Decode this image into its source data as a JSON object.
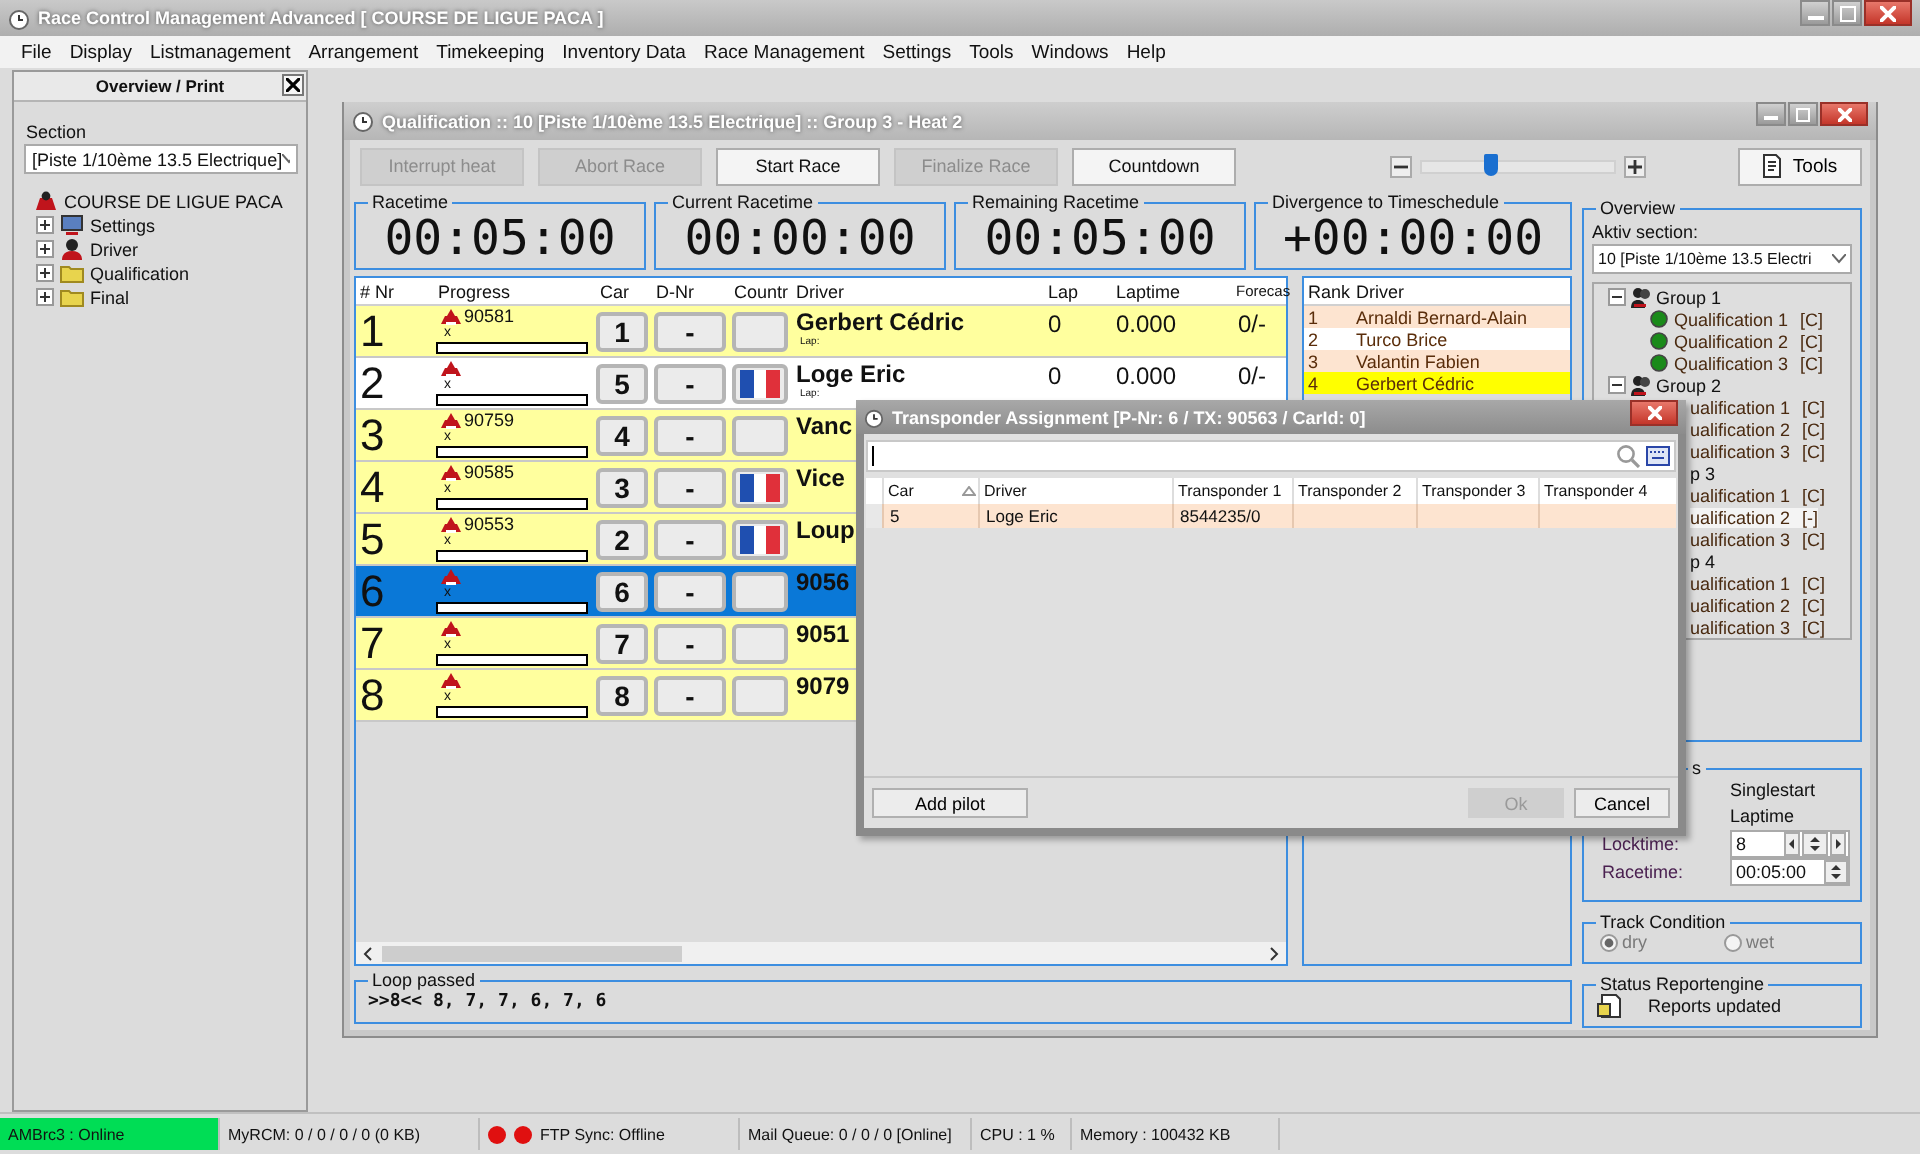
{
  "window": {
    "title": "Race Control Management Advanced  [ COURSE DE LIGUE PACA ]"
  },
  "menu": [
    "File",
    "Display",
    "Listmanagement",
    "Arrangement",
    "Timekeeping",
    "Inventory Data",
    "Race Management",
    "Settings",
    "Tools",
    "Windows",
    "Help"
  ],
  "left_panel": {
    "title": "Overview / Print",
    "section_label": "Section",
    "section_value": "[Piste 1/10ème 13.5 Electrique]",
    "tree": {
      "label": "COURSE DE LIGUE PACA",
      "children": [
        {
          "label": "Settings",
          "kind": "settings",
          "expanded": false
        },
        {
          "label": "Driver",
          "kind": "driver",
          "expanded": false
        },
        {
          "label": "Qualification",
          "kind": "folder",
          "expanded": false
        },
        {
          "label": "Final",
          "kind": "folder",
          "expanded": false
        }
      ]
    }
  },
  "race_window": {
    "title": "Qualification :: 10  [Piste 1/10ème 13.5 Electrique] :: Group 3 - Heat 2",
    "toolbar": [
      {
        "label": "Interrupt heat",
        "disabled": true
      },
      {
        "label": "Abort Race",
        "disabled": true
      },
      {
        "label": "Start Race",
        "disabled": false
      },
      {
        "label": "Finalize Race",
        "disabled": true
      },
      {
        "label": "Countdown",
        "disabled": false
      }
    ],
    "zoom_slider": {
      "level": 0.35
    },
    "tools_button": {
      "label": "Tools"
    },
    "timers": [
      {
        "label": "Racetime",
        "value": "00:05:00"
      },
      {
        "label": "Current Racetime",
        "value": "00:00:00"
      },
      {
        "label": "Remaining Racetime",
        "value": "00:05:00"
      },
      {
        "label": "Divergence to Timeschedule",
        "value": "+00:00:00"
      }
    ],
    "results_table": {
      "columns": [
        "# Nr",
        "Progress",
        "Car",
        "D-Nr",
        "Countr",
        "Driver",
        "Lap",
        "Laptime",
        "Forecas"
      ],
      "rows": [
        {
          "nr": "1",
          "transponder": "90581",
          "mark": "x",
          "car": "1",
          "d_nr": "-",
          "flag": false,
          "driver": "Gerbert Cédric",
          "lap_hint": "Lap:",
          "lap": "0",
          "laptime": "0.000",
          "forecast": "0/-",
          "highlighted": true,
          "selected": false
        },
        {
          "nr": "2",
          "mark": "x",
          "car": "5",
          "d_nr": "-",
          "flag": true,
          "driver": "Loge Eric",
          "lap_hint": "Lap:",
          "lap": "0",
          "laptime": "0.000",
          "forecast": "0/-",
          "highlighted": false,
          "selected": false
        },
        {
          "nr": "3",
          "transponder": "90759",
          "mark": "x",
          "car": "4",
          "d_nr": "-",
          "flag": false,
          "driver": "Vanc",
          "highlighted": true,
          "selected": false
        },
        {
          "nr": "4",
          "transponder": "90585",
          "mark": "x",
          "car": "3",
          "d_nr": "-",
          "flag": true,
          "driver": "Vice",
          "highlighted": true,
          "selected": false
        },
        {
          "nr": "5",
          "transponder": "90553",
          "mark": "x",
          "car": "2",
          "d_nr": "-",
          "flag": true,
          "driver": "Loup",
          "highlighted": true,
          "selected": false
        },
        {
          "nr": "6",
          "mark": "x",
          "car": "6",
          "d_nr": "-",
          "flag": false,
          "driver": "9056",
          "highlighted": true,
          "selected": true
        },
        {
          "nr": "7",
          "mark": "x",
          "car": "7",
          "d_nr": "-",
          "flag": false,
          "driver": "9051",
          "highlighted": true,
          "selected": false
        },
        {
          "nr": "8",
          "mark": "x",
          "car": "8",
          "d_nr": "-",
          "flag": false,
          "driver": "9079",
          "highlighted": true,
          "selected": false
        }
      ]
    },
    "rank_table": {
      "columns": [
        "Rank",
        "Driver"
      ],
      "rows": [
        {
          "rank": "1",
          "driver": "Arnaldi Bernard-Alain",
          "selected": false
        },
        {
          "rank": "2",
          "driver": "Turco Brice",
          "selected": false
        },
        {
          "rank": "3",
          "driver": "Valantin Fabien",
          "selected": false
        },
        {
          "rank": "4",
          "driver": "Gerbert Cédric",
          "selected": true
        }
      ]
    },
    "loop_passed": {
      "label": "Loop passed",
      "value": ">>8<< 8, 7, 7, 6, 7, 6"
    },
    "overview": {
      "label": "Overview",
      "section_label": "Aktiv section:",
      "section_value": "10  [Piste 1/10ème 13.5 Electri",
      "groups": [
        {
          "label": "Group 1",
          "covered": false,
          "expanded": true,
          "children": [
            {
              "label": "Qualification 1",
              "status": "[C]",
              "covered": false,
              "selected": false
            },
            {
              "label": "Qualification 2",
              "status": "[C]",
              "covered": false,
              "selected": false
            },
            {
              "label": "Qualification 3",
              "status": "[C]",
              "covered": false,
              "selected": false
            }
          ]
        },
        {
          "label": "Group 2",
          "covered": false,
          "expanded": true,
          "children": [
            {
              "label": "ualification 1",
              "status": "[C]",
              "covered": true,
              "selected": false
            },
            {
              "label": "ualification 2",
              "status": "[C]",
              "covered": true,
              "selected": false
            },
            {
              "label": "ualification 3",
              "status": "[C]",
              "covered": true,
              "selected": false
            }
          ]
        },
        {
          "label": "p 3",
          "covered": true,
          "expanded": true,
          "children": [
            {
              "label": "ualification 1",
              "status": "[C]",
              "covered": true,
              "selected": false
            },
            {
              "label": "ualification 2",
              "status": "[-]",
              "covered": true,
              "selected": true
            },
            {
              "label": "ualification 3",
              "status": "[C]",
              "covered": true,
              "selected": false
            }
          ]
        },
        {
          "label": "p 4",
          "covered": true,
          "expanded": true,
          "children": [
            {
              "label": "ualification 1",
              "status": "[C]",
              "covered": true,
              "selected": false
            },
            {
              "label": "ualification 2",
              "status": "[C]",
              "covered": true,
              "selected": false
            },
            {
              "label": "ualification 3",
              "status": "[C]",
              "covered": true,
              "selected": false
            }
          ]
        }
      ]
    },
    "settings_panel": {
      "label": "s",
      "start_mode": "Singlestart",
      "timing_mode": "Laptime",
      "fields": [
        {
          "label": "Locktime:",
          "value": "8",
          "kind": "stepper"
        },
        {
          "label": "Racetime:",
          "value": "00:05:00",
          "kind": "spin"
        }
      ]
    },
    "track_condition": {
      "label": "Track Condition",
      "disabled": true,
      "options": [
        {
          "label": "dry",
          "selected": true
        },
        {
          "label": "wet",
          "selected": false
        }
      ]
    },
    "status_reportengine": {
      "label": "Status Reportengine",
      "message": "Reports updated"
    }
  },
  "dialog": {
    "title": "Transponder Assignment [P-Nr: 6 / TX: 90563 / CarId: 0]",
    "columns": [
      {
        "label": "Car",
        "sorted": true
      },
      {
        "label": "Driver",
        "sorted": false
      },
      {
        "label": "Transponder 1",
        "sorted": false
      },
      {
        "label": "Transponder 2",
        "sorted": false
      },
      {
        "label": "Transponder 3",
        "sorted": false
      },
      {
        "label": "Transponder 4",
        "sorted": false
      }
    ],
    "rows": [
      {
        "car": "5",
        "driver": "Loge Eric",
        "transponder_1": "8544235/0"
      }
    ],
    "buttons": [
      {
        "label": "Add pilot",
        "disabled": false
      },
      {
        "label": "Ok",
        "disabled": true
      },
      {
        "label": "Cancel",
        "disabled": false
      }
    ]
  },
  "status_bar": [
    {
      "text": "AMBrc3 : Online",
      "color": "#00dd55"
    },
    {
      "text": "MyRCM: 0 / 0 / 0 / 0 (0 KB)"
    },
    {
      "text": "FTP Sync: Offline",
      "leds": [
        {
          "color": "#e01010"
        },
        {
          "color": "#e01010"
        }
      ]
    },
    {
      "text": "Mail Queue: 0 / 0 / 0 [Online]"
    },
    {
      "text": "CPU : 1 %"
    },
    {
      "text": "Memory : 100432 KB"
    }
  ]
}
